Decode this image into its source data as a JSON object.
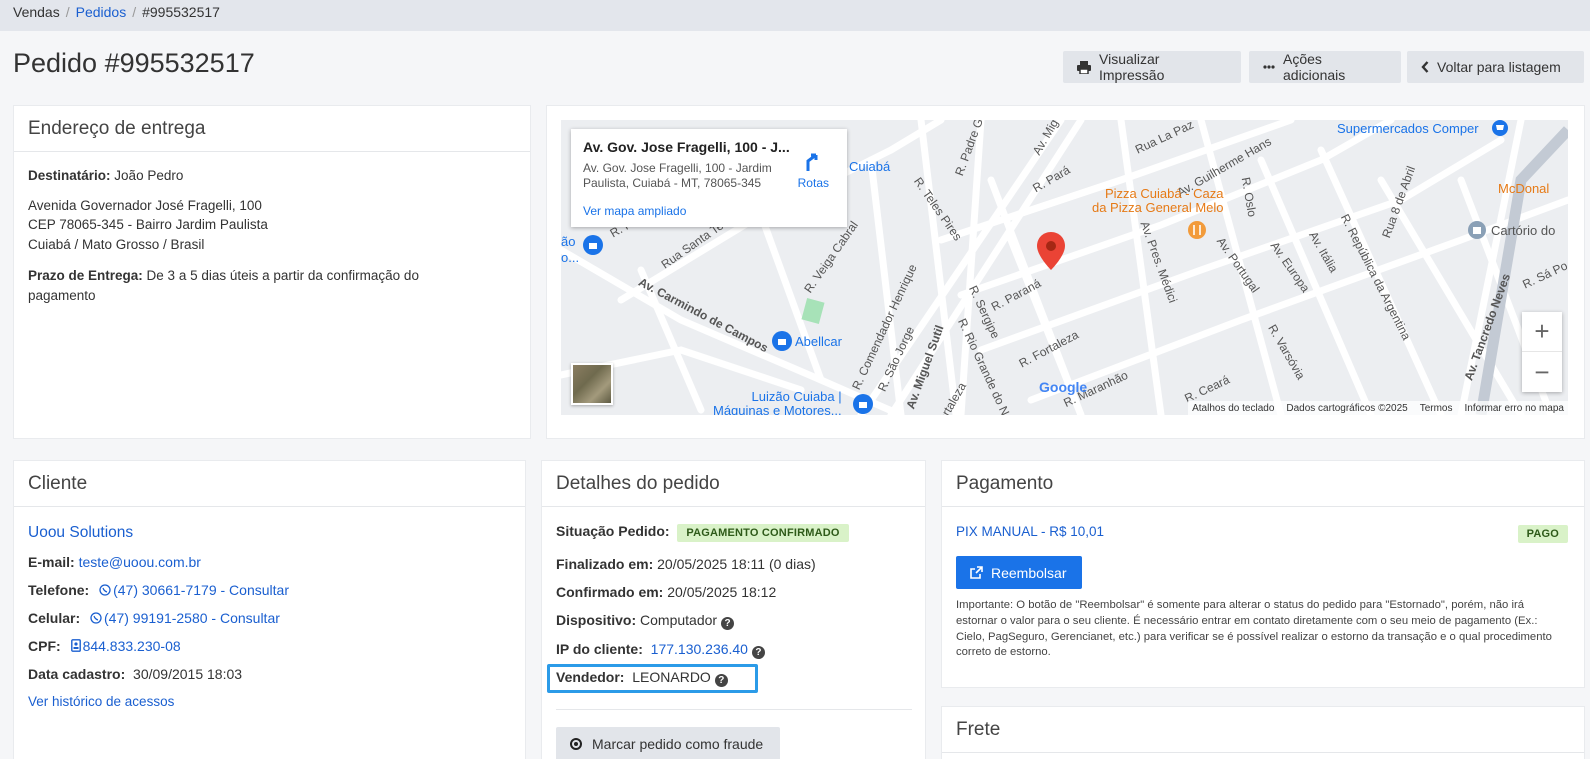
{
  "breadcrumb": {
    "items": [
      "Vendas",
      "Pedidos",
      "#995532517"
    ]
  },
  "page": {
    "title": "Pedido #995532517"
  },
  "toolbar": {
    "print_label": "Visualizar Impressão",
    "actions_label": "Ações adicionais",
    "back_label": "Voltar para listagem"
  },
  "delivery": {
    "title": "Endereço de entrega",
    "recipient_label": "Destinatário:",
    "recipient": "João Pedro",
    "address_line1": "Avenida Governador José Fragelli, 100",
    "address_line2": "CEP 78065-345 - Bairro Jardim Paulista",
    "address_line3": "Cuiabá / Mato Grosso / Brasil",
    "deadline_label": "Prazo de Entrega:",
    "deadline_text": "De 3 a 5 dias úteis a partir da confirmação do",
    "deadline_text2": "pagamento"
  },
  "map": {
    "popup_title": "Av. Gov. Jose Fragelli, 100 - J...",
    "popup_address": "Av. Gov. Jose Fragelli, 100 - Jardim Paulista, Cuiabá - MT, 78065-345",
    "popup_link": "Ver mapa ampliado",
    "route_label": "Rotas",
    "pois": {
      "supermarket": "Supermercados Comper",
      "pizza1": "Pizza Cuiabá - Caza",
      "pizza2": "da Pizza General Melo",
      "mcdonalds": "McDonal",
      "cartorio": "Cartório do",
      "abellcar": "Abellcar",
      "luizao1": "Luizão Cuiaba |",
      "luizao2": "Máquinas e Motores...",
      "cuiaba": "Cuiabá",
      "left1": "ão",
      "left2": "o..."
    },
    "streets": {
      "s1": "Av. Carmindo de Campos",
      "s2": "Rua Santa Te",
      "s3": "R. Veiga Cabral",
      "s4": "R. Comendador Henrique",
      "s5": "R. São Jorge",
      "s6": "Av. Miguel Sutil",
      "s7": "R. Rio Grande do N",
      "s8": "R. Sergipe",
      "s9": "R. Paraná",
      "s10": "R. Fortaleza",
      "s11": "R. Teles Pires",
      "s12": "Av. Pres. Médici",
      "s13": "Av. Portugal",
      "s14": "Av. Europa",
      "s15": "Av. Itália",
      "s16": "R. República da Argentina",
      "s17": "Av. Tancredo Neves",
      "s18": "R. Varsóvia",
      "s19": "Av. Guilherme Hans",
      "s20": "Rua La Paz",
      "s21": "R. Oslo",
      "s22": "Rua 8 de Abril",
      "s23": "R. Padre G",
      "s24": "R. Pará",
      "s25": "R. Maranhão",
      "s26": "R. Ceará",
      "s27": "R. Fe",
      "s28": "R. Sá Po",
      "s29": "Av. Mig",
      "s30": "ortaleza"
    },
    "google": "Google",
    "attribution": [
      "Atalhos do teclado",
      "Dados cartográficos ©2025",
      "Termos",
      "Informar erro no mapa"
    ]
  },
  "client": {
    "title": "Cliente",
    "name": "Uoou Solutions",
    "email_label": "E-mail:",
    "email": "teste@uoou.com.br",
    "phone_label": "Telefone:",
    "phone": "(47) 30661-7179 - Consultar",
    "mobile_label": "Celular:",
    "mobile": "(47) 99191-2580 - Consultar",
    "cpf_label": "CPF:",
    "cpf": "844.833.230-08",
    "signup_label": "Data cadastro:",
    "signup": "30/09/2015 18:03",
    "history_link": "Ver histórico de acessos"
  },
  "order": {
    "title": "Detalhes do pedido",
    "status_label": "Situação Pedido:",
    "status": "PAGAMENTO CONFIRMADO",
    "finished_label": "Finalizado em:",
    "finished": "20/05/2025 18:11 (0 dias)",
    "confirmed_label": "Confirmado em:",
    "confirmed": "20/05/2025 18:12",
    "device_label": "Dispositivo:",
    "device": "Computador",
    "ip_label": "IP do cliente:",
    "ip": "177.130.236.40",
    "seller_label": "Vendedor:",
    "seller": "LEONARDO",
    "fraud_button": "Marcar pedido como fraude"
  },
  "payment": {
    "title": "Pagamento",
    "method": "PIX MANUAL - R$ 10,01",
    "status": "PAGO",
    "refund_button": "Reembolsar",
    "note": "Importante: O botão de \"Reembolsar\" é somente para alterar o status do pedido para \"Estornado\", porém, não irá estornar o valor para o seu cliente. É necessário entrar em contato diretamente com o seu meio de pagamento (Ex.: Cielo, PagSeguro, Gerencianet, etc.) para verificar se é possível realizar o estorno da transação e o qual procedimento correto de estorno."
  },
  "shipping": {
    "title": "Frete"
  },
  "colors": {
    "accent": "#1a73e8",
    "link": "#1a5fd0",
    "paid_badge": "#d9f2c8",
    "highlight": "#2b9be8"
  }
}
